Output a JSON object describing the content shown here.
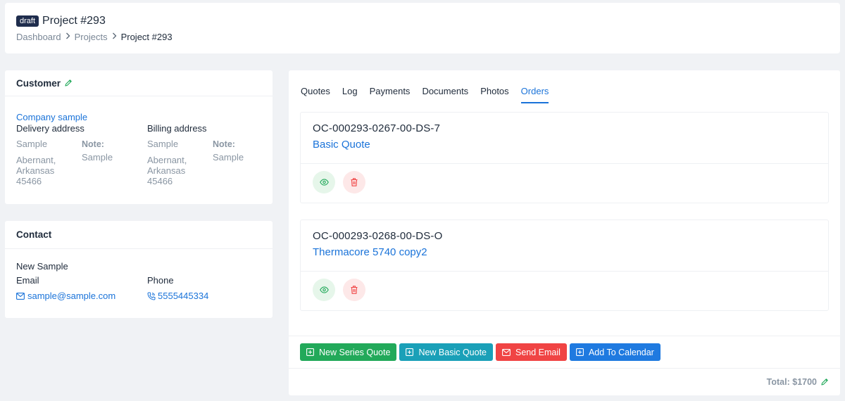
{
  "header": {
    "badge": "draft",
    "title": "Project #293",
    "breadcrumb": [
      "Dashboard",
      "Projects",
      "Project #293"
    ]
  },
  "customer": {
    "heading": "Customer",
    "company": "Company sample",
    "delivery": {
      "label": "Delivery address",
      "name": "Sample",
      "line1": "Abernant,",
      "line2": "Arkansas",
      "line3": "45466",
      "note_label": "Note:",
      "note_value": "Sample"
    },
    "billing": {
      "label": "Billing address",
      "name": "Sample",
      "line1": "Abernant,",
      "line2": "Arkansas",
      "line3": "45466",
      "note_label": "Note:",
      "note_value": "Sample"
    }
  },
  "contact": {
    "heading": "Contact",
    "name": "New Sample",
    "email_label": "Email",
    "email": "sample@sample.com",
    "phone_label": "Phone",
    "phone": "5555445334"
  },
  "tabs": [
    "Quotes",
    "Log",
    "Payments",
    "Documents",
    "Photos",
    "Orders"
  ],
  "active_tab": "Orders",
  "orders": [
    {
      "id": "OC-000293-0267-00-DS-7",
      "name": "Basic Quote"
    },
    {
      "id": "OC-000293-0268-00-DS-O",
      "name": "Thermacore 5740 copy2"
    }
  ],
  "actions": {
    "new_series": "New Series Quote",
    "new_basic": "New Basic Quote",
    "send_email": "Send Email",
    "add_calendar": "Add To Calendar"
  },
  "total": "Total: $1700",
  "colors": {
    "accent": "#1a73d9",
    "green": "#22a95a",
    "teal": "#1aa0b8",
    "red": "#f04444",
    "blue": "#1f7ae0",
    "badge": "#1f2d4d"
  }
}
